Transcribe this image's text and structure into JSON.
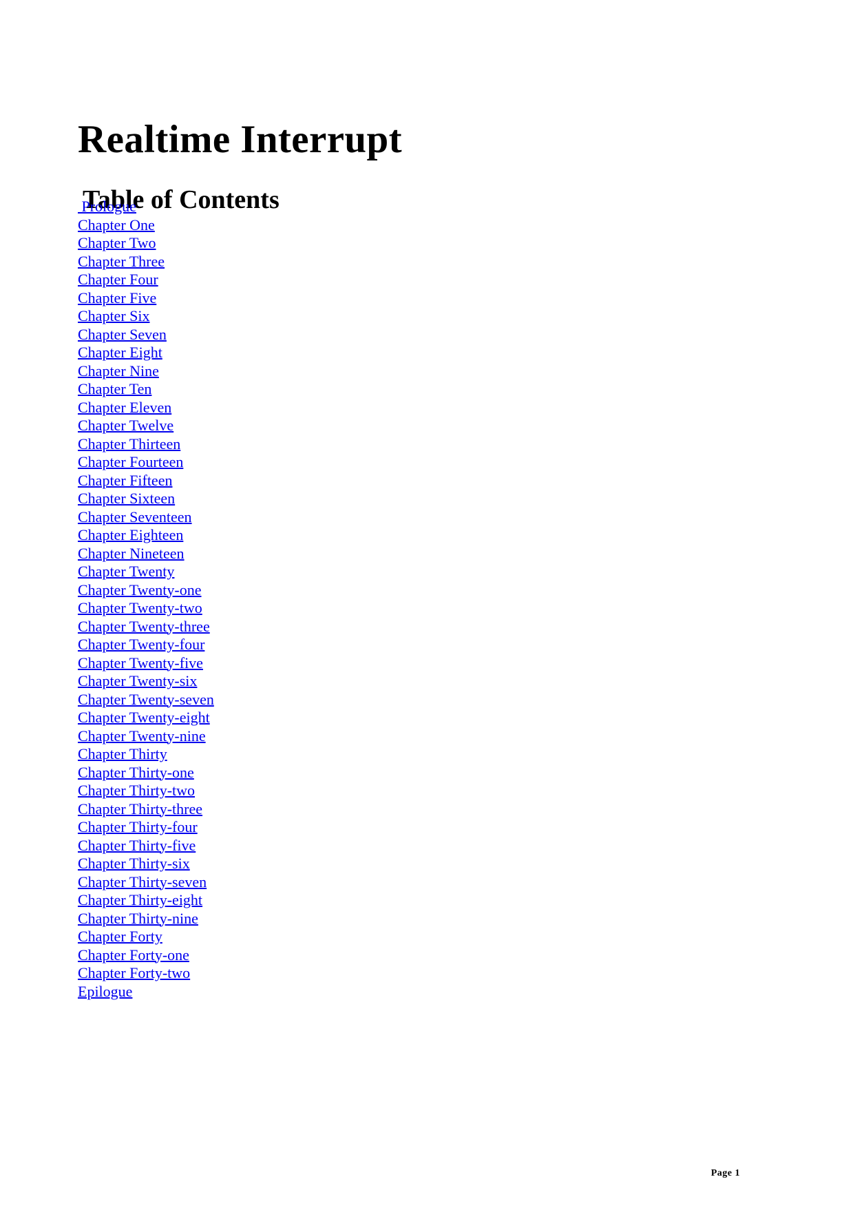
{
  "document": {
    "book_title": "Realtime Interrupt",
    "toc_heading": " Table of Contents",
    "footer": "Page 1"
  },
  "toc": {
    "entries": [
      {
        "label": " Prologue"
      },
      {
        "label": "Chapter One"
      },
      {
        "label": "Chapter Two"
      },
      {
        "label": "Chapter Three"
      },
      {
        "label": "Chapter Four"
      },
      {
        "label": "Chapter Five"
      },
      {
        "label": "Chapter Six"
      },
      {
        "label": "Chapter Seven"
      },
      {
        "label": "Chapter Eight"
      },
      {
        "label": "Chapter Nine"
      },
      {
        "label": "Chapter Ten"
      },
      {
        "label": "Chapter Eleven"
      },
      {
        "label": "Chapter Twelve"
      },
      {
        "label": "Chapter Thirteen"
      },
      {
        "label": "Chapter Fourteen"
      },
      {
        "label": "Chapter Fifteen"
      },
      {
        "label": "Chapter Sixteen"
      },
      {
        "label": "Chapter Seventeen"
      },
      {
        "label": "Chapter Eighteen"
      },
      {
        "label": "Chapter Nineteen"
      },
      {
        "label": "Chapter Twenty"
      },
      {
        "label": "Chapter Twenty-one"
      },
      {
        "label": "Chapter Twenty-two"
      },
      {
        "label": "Chapter Twenty-three"
      },
      {
        "label": "Chapter Twenty-four"
      },
      {
        "label": "Chapter Twenty-five"
      },
      {
        "label": "Chapter Twenty-six"
      },
      {
        "label": "Chapter Twenty-seven"
      },
      {
        "label": "Chapter Twenty-eight"
      },
      {
        "label": "Chapter Twenty-nine"
      },
      {
        "label": "Chapter Thirty"
      },
      {
        "label": "Chapter Thirty-one"
      },
      {
        "label": "Chapter Thirty-two"
      },
      {
        "label": "Chapter Thirty-three"
      },
      {
        "label": "Chapter Thirty-four"
      },
      {
        "label": "Chapter Thirty-five"
      },
      {
        "label": "Chapter Thirty-six"
      },
      {
        "label": "Chapter Thirty-seven"
      },
      {
        "label": "Chapter Thirty-eight"
      },
      {
        "label": "Chapter Thirty-nine"
      },
      {
        "label": "Chapter Forty"
      },
      {
        "label": "Chapter Forty-one"
      },
      {
        "label": "Chapter Forty-two"
      },
      {
        "label": "Epilogue"
      }
    ]
  },
  "colors": {
    "link": "#0000ee",
    "text": "#000000",
    "background": "#ffffff"
  }
}
